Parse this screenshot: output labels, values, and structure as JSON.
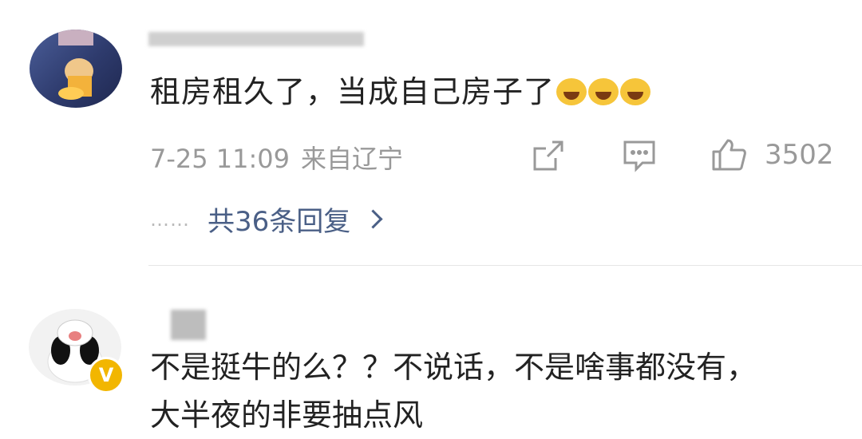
{
  "comments": [
    {
      "text": "租房租久了，当成自己房子了",
      "emojis": [
        "laugh-cry-emoji",
        "laugh-cry-emoji",
        "laugh-cry-emoji"
      ],
      "date": "7-25 11:09",
      "location": "来自辽宁",
      "likes": "3502",
      "replies_label": "共36条回复",
      "replies_dots": "……"
    },
    {
      "text_line1": "不是挺牛的么？？不说话，不是啥事都没有，",
      "text_line2": "大半夜的非要抽点风",
      "verified_badge": "V"
    }
  ],
  "colors": {
    "link": "#4a5f86",
    "meta": "#999999",
    "text": "#222222",
    "verified": "#f2b600"
  }
}
